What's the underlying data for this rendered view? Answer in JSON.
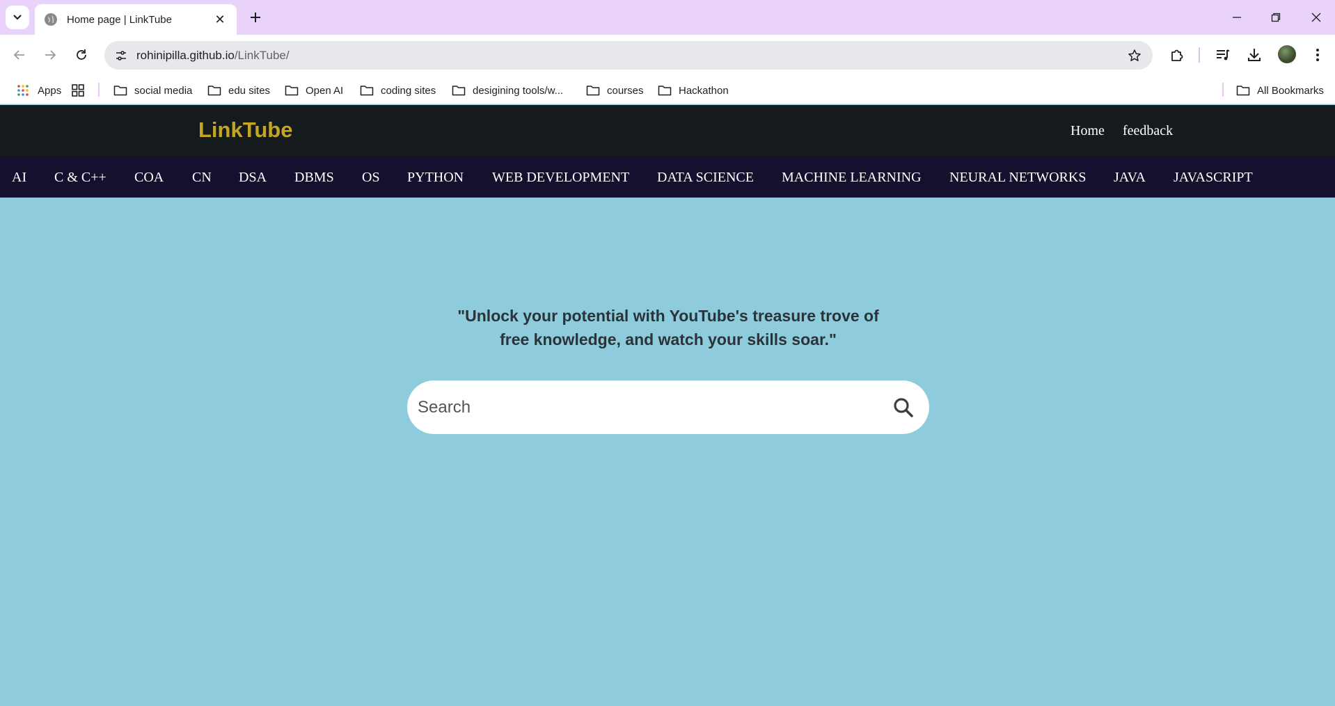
{
  "browser": {
    "tab_title": "Home page | LinkTube",
    "url_host": "rohinipilla.github.io",
    "url_path": "/LinkTube/",
    "bookmarks": [
      {
        "label": "Apps"
      },
      {
        "label": "social media"
      },
      {
        "label": "edu sites"
      },
      {
        "label": "Open AI"
      },
      {
        "label": "coding sites"
      },
      {
        "label": "desigining tools/w..."
      },
      {
        "label": "courses"
      },
      {
        "label": "Hackathon"
      }
    ],
    "all_bookmarks": "All Bookmarks"
  },
  "site": {
    "logo": "LinkTube",
    "nav": {
      "home": "Home",
      "feedback": "feedback"
    },
    "categories": [
      "AI",
      "C & C++",
      "COA",
      "CN",
      "DSA",
      "DBMS",
      "OS",
      "PYTHON",
      "WEB DEVELOPMENT",
      "DATA SCIENCE",
      "MACHINE LEARNING",
      "NEURAL NETWORKS",
      "JAVA",
      "JAVASCRIPT"
    ],
    "quote_line1": "\"Unlock your potential with YouTube's treasure trove of",
    "quote_line2": "free knowledge, and watch your skills soar.\"",
    "search": {
      "placeholder": "Search",
      "value": ""
    }
  },
  "colors": {
    "tabbar": "#e9d3fb",
    "header_bg": "#151a1c",
    "logo": "#c5a624",
    "category_bar": "#170f2e",
    "page_bg": "#8ecbdc"
  }
}
